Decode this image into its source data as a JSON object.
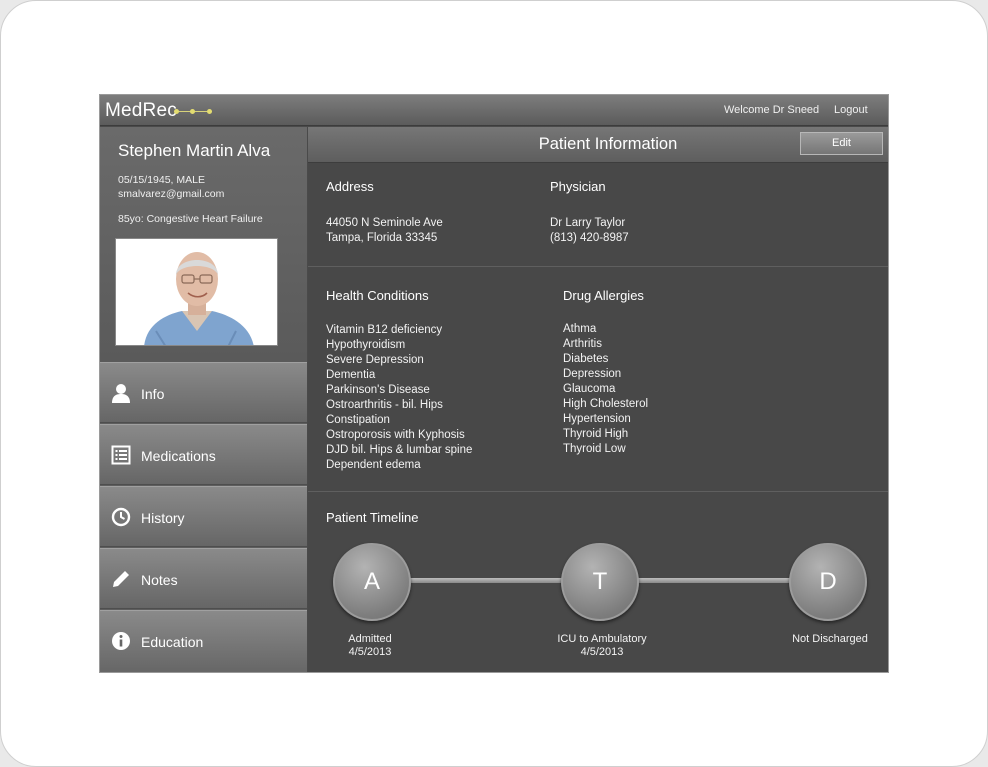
{
  "header": {
    "logo": "MedRec",
    "welcome": "Welcome Dr Sneed",
    "logout": "Logout"
  },
  "patient": {
    "name": "Stephen Martin Alva",
    "dob_sex": "05/15/1945, MALE",
    "email": "smalvarez@gmail.com",
    "diagnosis": "85yo: Congestive Heart Failure"
  },
  "nav": {
    "items": [
      {
        "label": "Info",
        "icon": "person-icon"
      },
      {
        "label": "Medications",
        "icon": "list-icon"
      },
      {
        "label": "History",
        "icon": "clock-icon"
      },
      {
        "label": "Notes",
        "icon": "pencil-icon"
      },
      {
        "label": "Education",
        "icon": "info-icon"
      }
    ]
  },
  "main": {
    "title": "Patient Information",
    "edit_label": "Edit",
    "address": {
      "title": "Address",
      "line1": "44050 N Seminole Ave",
      "line2": "Tampa, Florida 33345"
    },
    "physician": {
      "title": "Physician",
      "name": "Dr Larry Taylor",
      "phone": "(813) 420-8987"
    },
    "health_conditions": {
      "title": "Health Conditions",
      "items": [
        "Vitamin B12 deficiency",
        "Hypothyroidism",
        "Severe Depression",
        "Dementia",
        "Parkinson's Disease",
        "Ostroarthritis - bil. Hips",
        "Constipation",
        "Ostroporosis with Kyphosis",
        "DJD bil. Hips & lumbar spine",
        "Dependent edema"
      ]
    },
    "drug_allergies": {
      "title": "Drug Allergies",
      "items": [
        "Athma",
        "Arthritis",
        "Diabetes",
        "Depression",
        "Glaucoma",
        "High Cholesterol",
        "Hypertension",
        "Thyroid High",
        "Thyroid Low"
      ]
    },
    "timeline": {
      "title": "Patient Timeline",
      "nodes": [
        {
          "letter": "A",
          "label": "Admitted",
          "date": "4/5/2013"
        },
        {
          "letter": "T",
          "label": "ICU to Ambulatory",
          "date": "4/5/2013"
        },
        {
          "letter": "D",
          "label": "Not Discharged",
          "date": ""
        }
      ]
    }
  },
  "colors": {
    "logo_accent": "#e3dc70",
    "app_bg": "#4a4a4a",
    "sidebar_bg": "#5e5e5e"
  }
}
